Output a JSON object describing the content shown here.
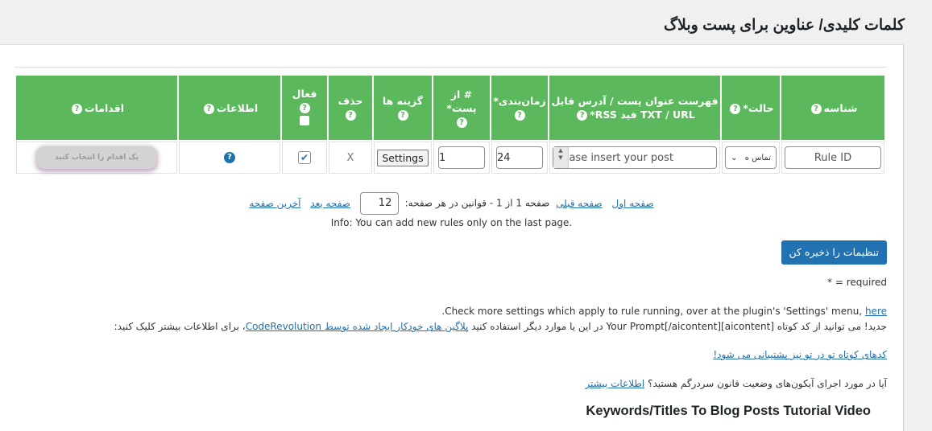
{
  "page": {
    "title": "کلمات کلیدی/ عناوین برای پست وبلاگ"
  },
  "table": {
    "headers": {
      "id": "شناسه",
      "status": "حالت*",
      "list": "فهرست عنوان پست / آدرس فایل TXT / URL فید RSS*",
      "schedule": "زمان‌بندی*",
      "count": "# از پست*",
      "options": "گزینه ها",
      "delete": "حذف",
      "active": "فعال",
      "info": "اطلاعات",
      "actions": "اقدامات"
    },
    "help_glyph": "?",
    "row": {
      "rule_id_placeholder": "Rule ID",
      "status_value": "تماس ه",
      "list_placeholder": "Please insert your post",
      "schedule": "24",
      "count": "1",
      "settings_label": "Settings",
      "delete_glyph": "X",
      "active_checked": true,
      "check_glyph": "✔",
      "action_label": "یک اقدام را انتخاب کنید"
    }
  },
  "pager": {
    "first": "صفحه اول",
    "prev": "صفحه قبلی",
    "status": "صفحه 1 از 1 - قوانین در هر صفحه:",
    "per_page": "12",
    "next": "صفحه بعد",
    "last": "آخرین صفحه",
    "info": "Info: You can add new rules only on the last page."
  },
  "save_label": "تنظیمات را ذخیره کن",
  "required_note": "* = required",
  "notes": {
    "settings_text": "Check more settings which apply to rule running, over at the plugin's 'Settings' menu,",
    "settings_link": "here",
    "shortcode_pre": "جدید! می توانید از کد کوتاه [aicontent]Your Prompt[/aicontent] در این یا موارد دیگر استفاده کنید",
    "shortcode_link": "پلاگین های خودکار ایجاد شده توسط CodeRevolution",
    "shortcode_post": "، برای اطلاعات بیشتر کلیک کنید:",
    "shortcodes_supported": "کدهای کوتاه تو در تو نیز پشتیبانی می شود!",
    "icons_question": "آیا در مورد اجرای آیکون‌های وضعیت قانون سردرگم هستید؟",
    "more_info": "اطلاعات بیشتر"
  },
  "video_title": "Keywords/Titles To Blog Posts Tutorial Video"
}
